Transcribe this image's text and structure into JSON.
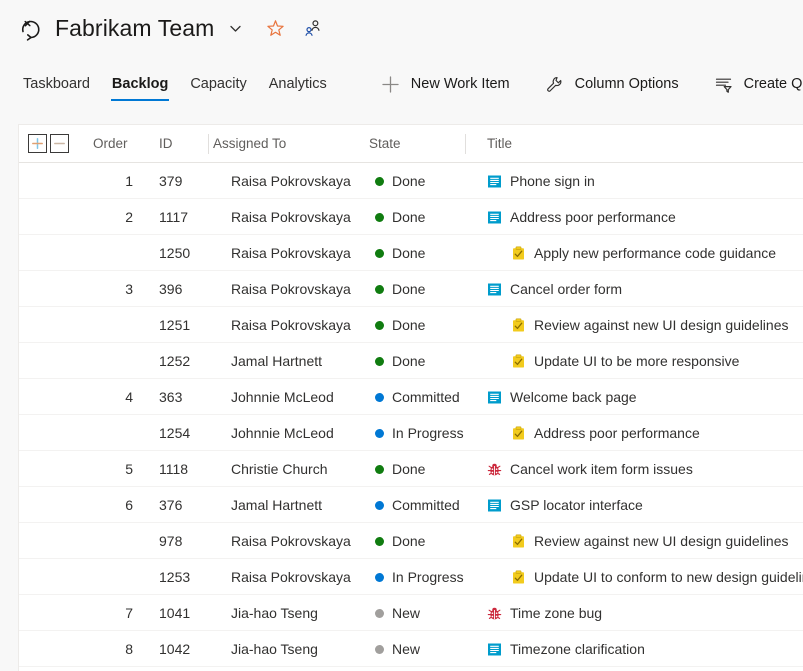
{
  "header": {
    "team_name": "Fabrikam Team",
    "team_icon": "backlog-board-icon",
    "chevron_icon": "chevron-down-icon",
    "favorite_icon": "star-icon",
    "members_icon": "team-members-icon"
  },
  "tabs": [
    {
      "label": "Taskboard",
      "active": false
    },
    {
      "label": "Backlog",
      "active": true
    },
    {
      "label": "Capacity",
      "active": false
    },
    {
      "label": "Analytics",
      "active": false
    }
  ],
  "toolbar": [
    {
      "label": "New Work Item",
      "icon": "plus-icon"
    },
    {
      "label": "Column Options",
      "icon": "wrench-icon"
    },
    {
      "label": "Create Query",
      "icon": "filter-icon"
    }
  ],
  "grid": {
    "expand_all_label": "+",
    "collapse_all_label": "–",
    "columns": [
      {
        "key": "order",
        "label": "Order"
      },
      {
        "key": "id",
        "label": "ID"
      },
      {
        "key": "assigned_to",
        "label": "Assigned To"
      },
      {
        "key": "state",
        "label": "State"
      },
      {
        "key": "title",
        "label": "Title"
      }
    ],
    "state_colors": {
      "Done": "#107c10",
      "Committed": "#0078d4",
      "In Progress": "#0078d4",
      "New": "#a19f9d"
    },
    "type_colors": {
      "pbi": "#009ccc",
      "task": "#f2cb1d",
      "bug": "#cc293d"
    },
    "rows": [
      {
        "order": "1",
        "id": "379",
        "assigned_to": "Raisa Pokrovskaya",
        "state": "Done",
        "title": "Phone sign in",
        "type": "pbi",
        "indent": 0,
        "expandable": false
      },
      {
        "order": "2",
        "id": "1117",
        "assigned_to": "Raisa Pokrovskaya",
        "state": "Done",
        "title": "Address poor performance",
        "type": "pbi",
        "indent": 0,
        "expandable": true
      },
      {
        "order": "",
        "id": "1250",
        "assigned_to": "Raisa Pokrovskaya",
        "state": "Done",
        "title": "Apply new performance code guidance",
        "type": "task",
        "indent": 1,
        "expandable": false
      },
      {
        "order": "3",
        "id": "396",
        "assigned_to": "Raisa Pokrovskaya",
        "state": "Done",
        "title": "Cancel order form",
        "type": "pbi",
        "indent": 0,
        "expandable": true
      },
      {
        "order": "",
        "id": "1251",
        "assigned_to": "Raisa Pokrovskaya",
        "state": "Done",
        "title": "Review against new UI design guidelines",
        "type": "task",
        "indent": 1,
        "expandable": false
      },
      {
        "order": "",
        "id": "1252",
        "assigned_to": "Jamal Hartnett",
        "state": "Done",
        "title": "Update UI to be more responsive",
        "type": "task",
        "indent": 1,
        "expandable": false
      },
      {
        "order": "4",
        "id": "363",
        "assigned_to": "Johnnie McLeod",
        "state": "Committed",
        "title": "Welcome back page",
        "type": "pbi",
        "indent": 0,
        "expandable": true
      },
      {
        "order": "",
        "id": "1254",
        "assigned_to": "Johnnie McLeod",
        "state": "In Progress",
        "title": "Address poor performance",
        "type": "task",
        "indent": 1,
        "expandable": false
      },
      {
        "order": "5",
        "id": "1118",
        "assigned_to": "Christie Church",
        "state": "Done",
        "title": "Cancel work item form issues",
        "type": "bug",
        "indent": 0,
        "expandable": false
      },
      {
        "order": "6",
        "id": "376",
        "assigned_to": "Jamal Hartnett",
        "state": "Committed",
        "title": "GSP locator interface",
        "type": "pbi",
        "indent": 0,
        "expandable": true
      },
      {
        "order": "",
        "id": "978",
        "assigned_to": "Raisa Pokrovskaya",
        "state": "Done",
        "title": "Review against new UI design guidelines",
        "type": "task",
        "indent": 1,
        "expandable": false
      },
      {
        "order": "",
        "id": "1253",
        "assigned_to": "Raisa Pokrovskaya",
        "state": "In Progress",
        "title": "Update UI to conform to new design guidelines",
        "type": "task",
        "indent": 1,
        "expandable": false
      },
      {
        "order": "7",
        "id": "1041",
        "assigned_to": "Jia-hao Tseng",
        "state": "New",
        "title": "Time zone bug",
        "type": "bug",
        "indent": 0,
        "expandable": false
      },
      {
        "order": "8",
        "id": "1042",
        "assigned_to": "Jia-hao Tseng",
        "state": "New",
        "title": "Timezone clarification",
        "type": "pbi",
        "indent": 0,
        "expandable": false
      }
    ]
  }
}
